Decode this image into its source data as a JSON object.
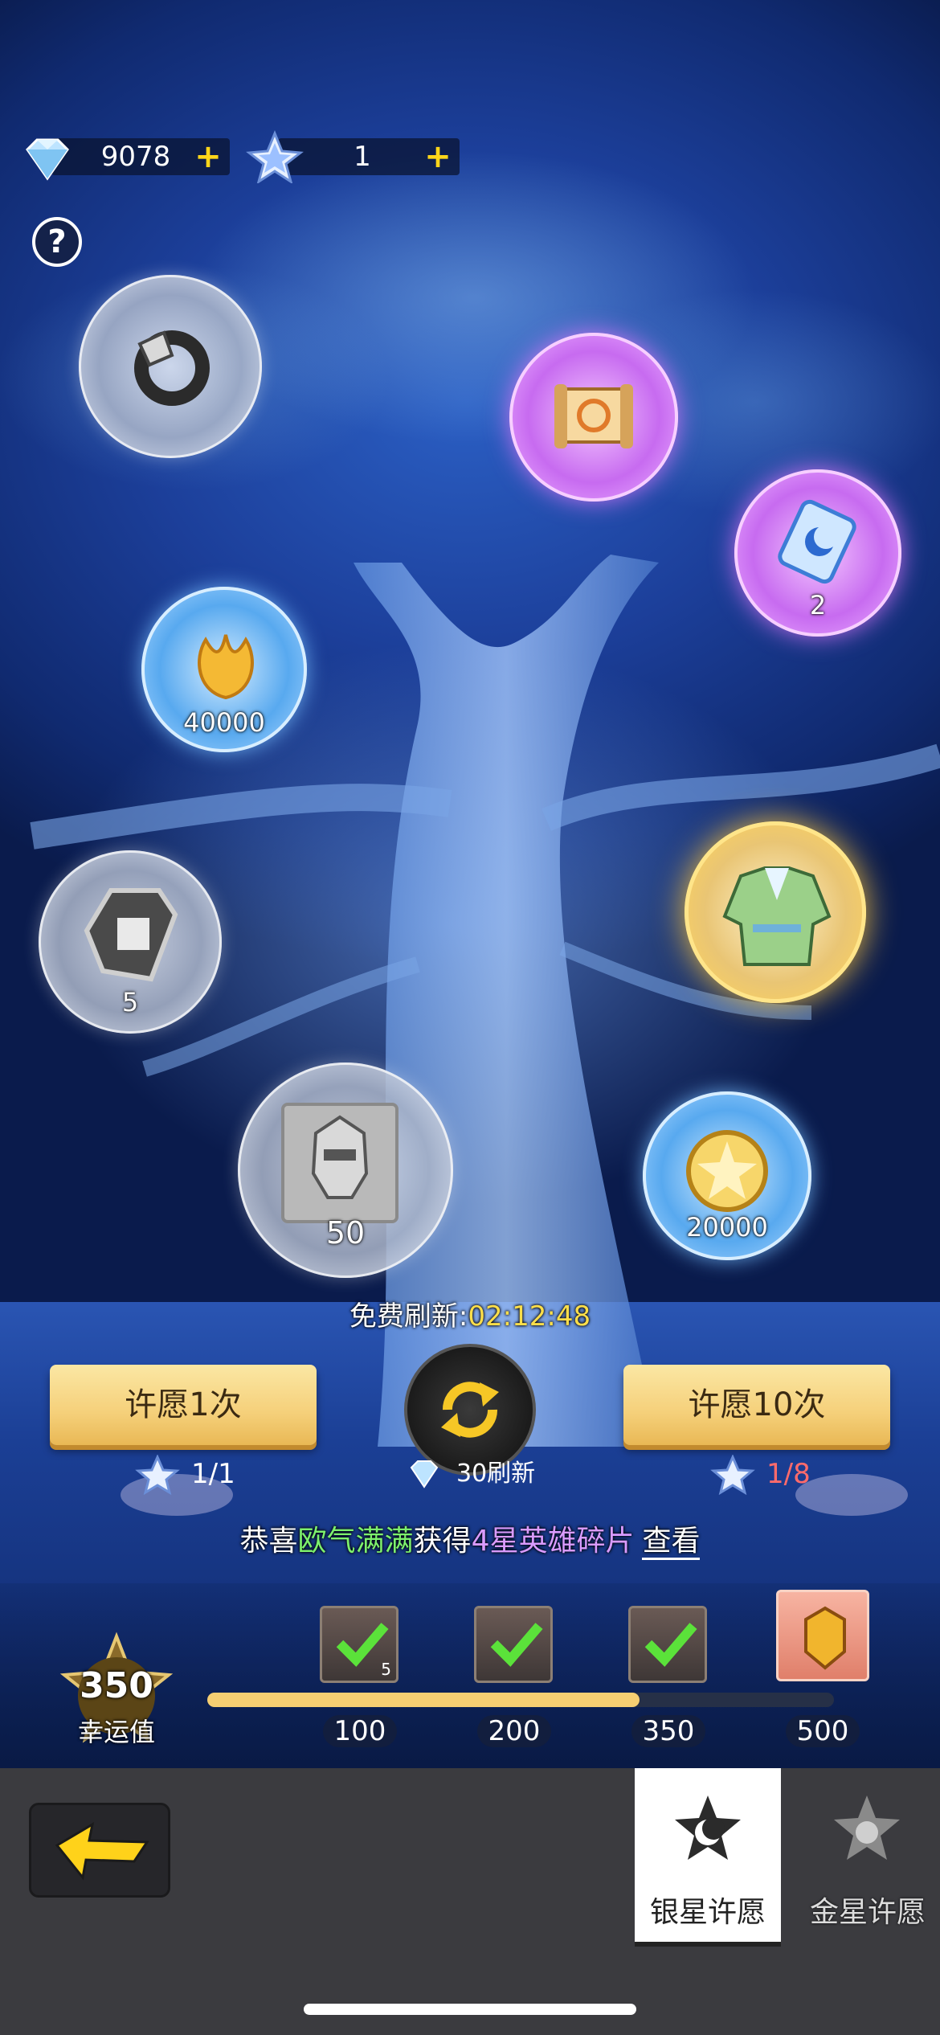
{
  "currencies": [
    {
      "name": "diamond",
      "icon": "diamond-icon",
      "value": "9078",
      "plus": "+"
    },
    {
      "name": "silver-star",
      "icon": "silver-star-icon",
      "value": "1",
      "plus": "+"
    }
  ],
  "help": {
    "label": "?"
  },
  "bubbles": [
    {
      "item": "ring-icon",
      "qty": ""
    },
    {
      "item": "scroll-icon",
      "qty": ""
    },
    {
      "item": "moon-ticket-icon",
      "qty": "2"
    },
    {
      "item": "golden-lotus-icon",
      "qty": "40000"
    },
    {
      "item": "exchange-token-icon",
      "qty": "5"
    },
    {
      "item": "green-armor-icon",
      "qty": ""
    },
    {
      "item": "hero-fragment-icon",
      "qty": "50"
    },
    {
      "item": "gold-coin-icon",
      "qty": "20000"
    }
  ],
  "timer": {
    "label": "免费刷新:",
    "value": "02:12:48"
  },
  "actions": {
    "wish_once": "许愿1次",
    "wish_ten": "许愿10次",
    "refresh_cost": "30刷新",
    "wish_once_cost": "1/1",
    "wish_ten_cost": "1/8"
  },
  "notice": {
    "prefix": "恭喜",
    "player": "欧气满满",
    "mid": "获得",
    "item": "4星英雄碎片",
    "link": "查看"
  },
  "luck": {
    "value": "350",
    "label": "幸运值",
    "max": 500
  },
  "milestones": [
    {
      "value": "100",
      "claimed": true,
      "reward_qty": "5"
    },
    {
      "value": "200",
      "claimed": true,
      "reward_qty": ""
    },
    {
      "value": "350",
      "claimed": true,
      "reward_qty": ""
    },
    {
      "value": "500",
      "claimed": false,
      "reward_qty": ""
    }
  ],
  "tabs": [
    {
      "label": "银星许愿",
      "active": true
    },
    {
      "label": "金星许愿",
      "active": false
    }
  ],
  "colors": {
    "accent_gold": "#f6cf72",
    "timer_yellow": "#ffdf4a",
    "notice_green": "#7df06d",
    "notice_purple": "#d99bff",
    "cost_red": "#ff6b6b"
  }
}
